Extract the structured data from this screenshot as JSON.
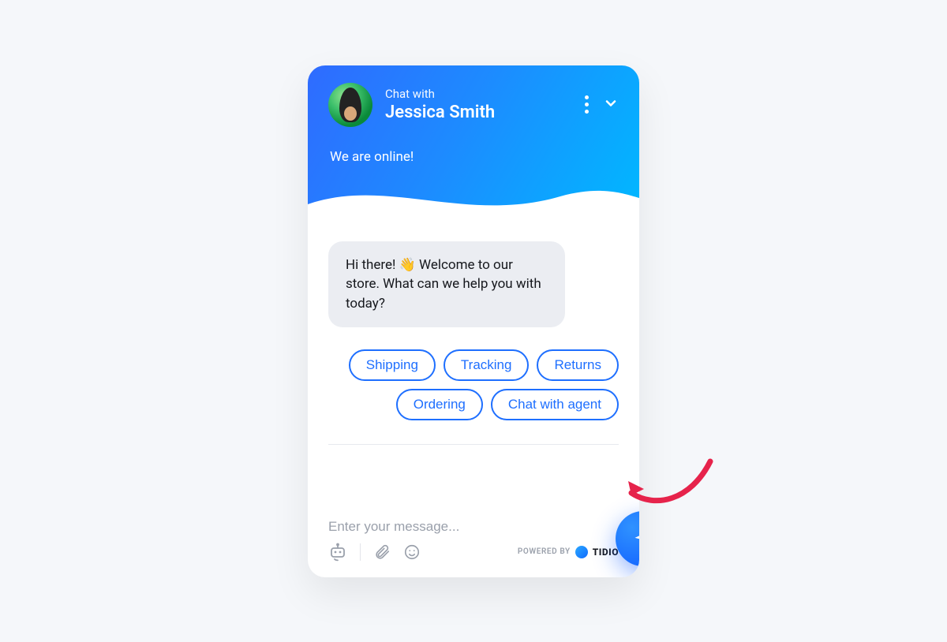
{
  "header": {
    "chat_with_label": "Chat with",
    "agent_name": "Jessica Smith",
    "status_text": "We are online!"
  },
  "welcome_message": "Hi there! 👋 Welcome to our store. What can we help you with today?",
  "quick_replies": {
    "shipping": "Shipping",
    "tracking": "Tracking",
    "returns": "Returns",
    "ordering": "Ordering",
    "chat_agent": "Chat with agent"
  },
  "composer": {
    "placeholder": "Enter your message..."
  },
  "footer": {
    "powered_by": "POWERED BY",
    "brand": "TIDIO"
  }
}
